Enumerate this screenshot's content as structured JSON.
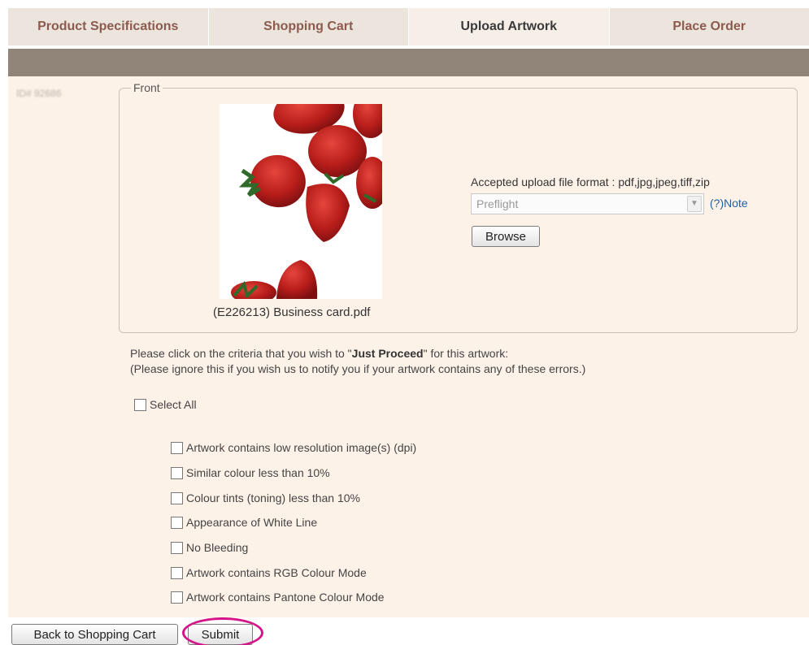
{
  "tabs": [
    {
      "label": "Product Specifications",
      "active": false
    },
    {
      "label": "Shopping Cart",
      "active": false
    },
    {
      "label": "Upload Artwork",
      "active": true
    },
    {
      "label": "Place Order",
      "active": false
    }
  ],
  "order_id": "ID# 92686",
  "front": {
    "legend": "Front",
    "filename": "(E226213) Business card.pdf",
    "accepted_formats": "Accepted upload file format : pdf,jpg,jpeg,tiff,zip",
    "preflight_value": "Preflight",
    "note_label": "(?)Note",
    "browse_label": "Browse"
  },
  "criteria": {
    "line1_prefix": "Please click on the criteria that you wish to \"",
    "line1_bold": "Just Proceed",
    "line1_suffix": "\" for this artwork:",
    "line2": "(Please ignore this if you wish us to notify you if your artwork contains any of these errors.)",
    "select_all": "Select All",
    "items": [
      "Artwork contains low resolution image(s) (dpi)",
      "Similar colour less than 10%",
      "Colour tints (toning) less than 10%",
      "Appearance of White Line",
      "No Bleeding",
      "Artwork contains RGB Colour Mode",
      "Artwork contains Pantone Colour Mode"
    ]
  },
  "buttons": {
    "back": "Back to Shopping Cart",
    "submit": "Submit"
  },
  "colors": {
    "tab_text": "#8d5a4e",
    "bar": "#918478",
    "content_bg": "#fdf2e8",
    "highlight": "#d6148a"
  }
}
